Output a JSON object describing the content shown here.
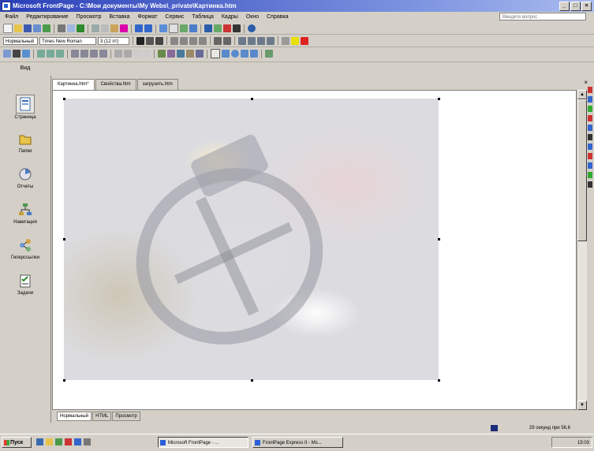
{
  "window": {
    "title": "Microsoft FrontPage - C:\\Мои документы\\My Webs\\_private\\Картинка.htm",
    "buttons": [
      "_",
      "□",
      "×"
    ]
  },
  "menubar": {
    "items": [
      "Файл",
      "Редактирование",
      "Просмотр",
      "Вставка",
      "Формат",
      "Сервис",
      "Таблица",
      "Кадры",
      "Окно",
      "Справка"
    ],
    "help_placeholder": "Введите вопрос"
  },
  "format_toolbar": {
    "style_value": "Нормальный",
    "font_value": "Times New Roman",
    "size_value": "3 (12 пт)"
  },
  "views": {
    "header": "Вид",
    "items": [
      {
        "label": "Страница",
        "icon": "page-view-icon"
      },
      {
        "label": "Папки",
        "icon": "folders-view-icon"
      },
      {
        "label": "Отчеты",
        "icon": "reports-view-icon"
      },
      {
        "label": "Навигация",
        "icon": "navigation-view-icon"
      },
      {
        "label": "Гиперссылки",
        "icon": "hyperlinks-view-icon"
      },
      {
        "label": "Задачи",
        "icon": "tasks-view-icon"
      }
    ]
  },
  "tabs": [
    "Картинка.htm*",
    "Свойства.htm",
    "загрузить.htm"
  ],
  "view_tabs": [
    "Нормальный",
    "HTML",
    "Просмотр"
  ],
  "statusbar": {
    "text": "29 секунд при 56,6"
  },
  "taskbar": {
    "start_label": "Пуск",
    "tasks": [
      "Microsoft FrontPage - ...",
      "FrontPage Express II - Ms..."
    ],
    "clock": "15:03"
  },
  "colors": {
    "title_bar": "#2a3fb8",
    "face": "#d4d0c8"
  }
}
